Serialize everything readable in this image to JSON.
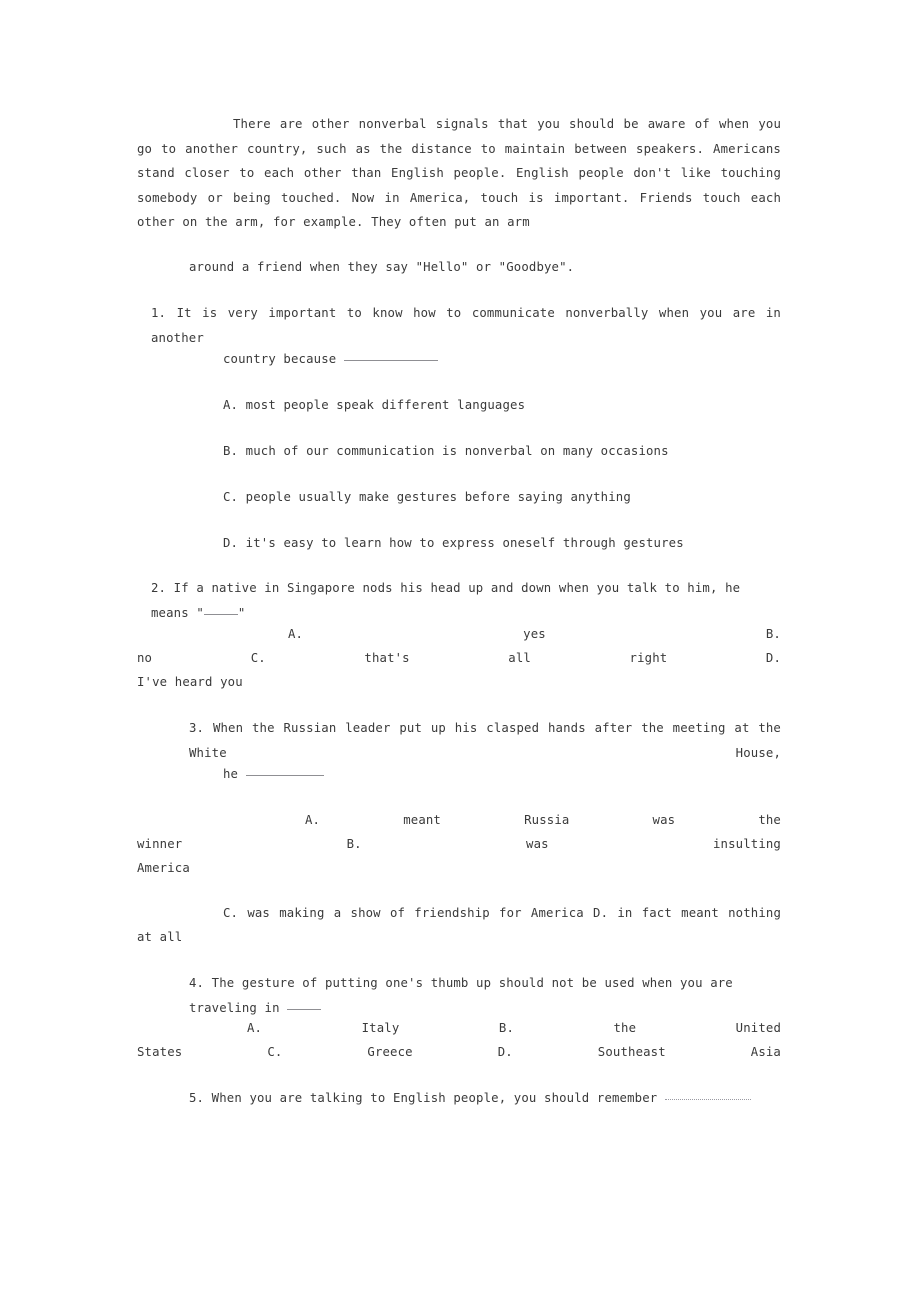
{
  "document": {
    "passage": {
      "paragraph_1": "There are other nonverbal signals that you should be aware of when you go to another country, such as the distance to maintain between speakers.   Americans stand closer to each other than English people.   English people don't like touching somebody or being touched.   Now in America, touch is important. Friends touch each other on the arm, for example. They often put an arm",
      "paragraph_2": "around a friend when they say \"Hello\" or \"Goodbye\"."
    },
    "questions": [
      {
        "number": "1.",
        "stem_line_1": "It is very important to know how to communicate nonverbally when you are in another",
        "stem_line_2": "country because",
        "options": [
          {
            "letter": "A.",
            "text": "most people speak different languages"
          },
          {
            "letter": "B.",
            "text": "much of our communication is nonverbal on many occasions"
          },
          {
            "letter": "C.",
            "text": "people usually make gestures before saying anything"
          },
          {
            "letter": "D.",
            "text": "it's easy to learn how to express oneself through gestures"
          }
        ]
      },
      {
        "number": "2.",
        "stem_prefix": "If a native in Singapore nods his head up and down when you talk to him, he means",
        "stem_quote_open": "\"",
        "stem_quote_close": "\"",
        "options_row_1": {
          "a_letter": "A.",
          "a_text": "yes",
          "b_letter": "B."
        },
        "options_row_2": {
          "b_text": "no",
          "c_letter": "C.",
          "c_text": "that's all right",
          "d_letter": "D."
        },
        "options_row_3": {
          "d_text": "I've heard you"
        }
      },
      {
        "number": "3.",
        "stem_line_1": "When the Russian leader put up his clasped hands after the meeting at the White House,",
        "stem_line_2": "he",
        "options_row_1": {
          "a_letter": "A.",
          "w1": "meant",
          "w2": "Russia",
          "w3": "was",
          "w4": "the"
        },
        "options_row_2": {
          "a_tail": "winner",
          "b_letter": "B.",
          "b_w1": "was",
          "b_w2": "insulting"
        },
        "options_row_3": {
          "b_tail": "America"
        },
        "options_row_4": {
          "c_text": "C. was making a show of friendship for America",
          "d_text": "D. in fact meant nothing"
        },
        "options_row_5": {
          "d_tail": "at all"
        }
      },
      {
        "number": "4.",
        "stem": "The gesture of putting one's thumb up should not be used when you are traveling in",
        "options_row_1": {
          "a_letter": "A.",
          "a_text": "Italy",
          "b_letter": "B.",
          "b_w1": "the",
          "b_w2": "United"
        },
        "options_row_2": {
          "b_tail": "States",
          "c_text": "C. Greece",
          "d_text": "D. Southeast Asia"
        }
      },
      {
        "number": "5.",
        "stem": "When you are talking to English people, you should remember"
      }
    ]
  }
}
